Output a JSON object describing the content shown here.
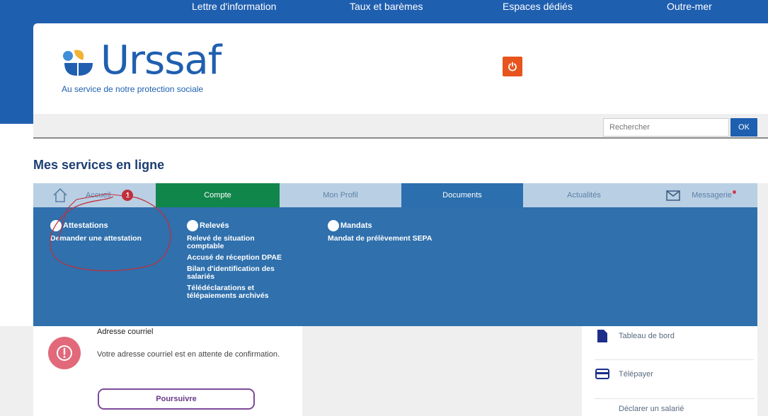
{
  "top_nav": [
    "Lettre d'information",
    "Taux et barèmes",
    "Espaces dédiés",
    "Outre-mer"
  ],
  "logo": {
    "word": "Urssaf",
    "tagline": "Au service de notre protection sociale"
  },
  "search": {
    "placeholder": "Rechercher",
    "button": "OK"
  },
  "page_title": "Mes services en ligne",
  "tabs": {
    "accueil": "Accueil",
    "badge": "1",
    "compte": "Compte",
    "mon_profil": "Mon Profil",
    "documents": "Documents",
    "actualites": "Actualités",
    "messagerie": "Messagerie"
  },
  "dropdown": {
    "attestations": {
      "title": "Attestations",
      "links": [
        "Demander une attestation"
      ]
    },
    "releves": {
      "title": "Relevés",
      "links": [
        "Relevé de situation comptable",
        "Accusé de réception DPAE",
        "Bilan d'identification des salariés",
        "Télédéclarations et télépaiements archivés"
      ]
    },
    "mandats": {
      "title": "Mandats",
      "links": [
        "Mandat de prélèvement SEPA"
      ]
    }
  },
  "alert": {
    "title": "Adresse courriel",
    "text": "Votre adresse courriel est en attente de confirmation.",
    "button": "Poursuivre"
  },
  "quick_links": [
    "Tableau de bord",
    "Télépayer",
    "Déclarer un salarié"
  ],
  "colors": {
    "brand_blue": "#1f5fb0",
    "menu_blue": "#2f70ad",
    "green": "#11864a",
    "orange": "#e8541e",
    "alert_pink": "#e2697a",
    "purple": "#7d4a9c",
    "annotation_red": "#c0303c"
  }
}
